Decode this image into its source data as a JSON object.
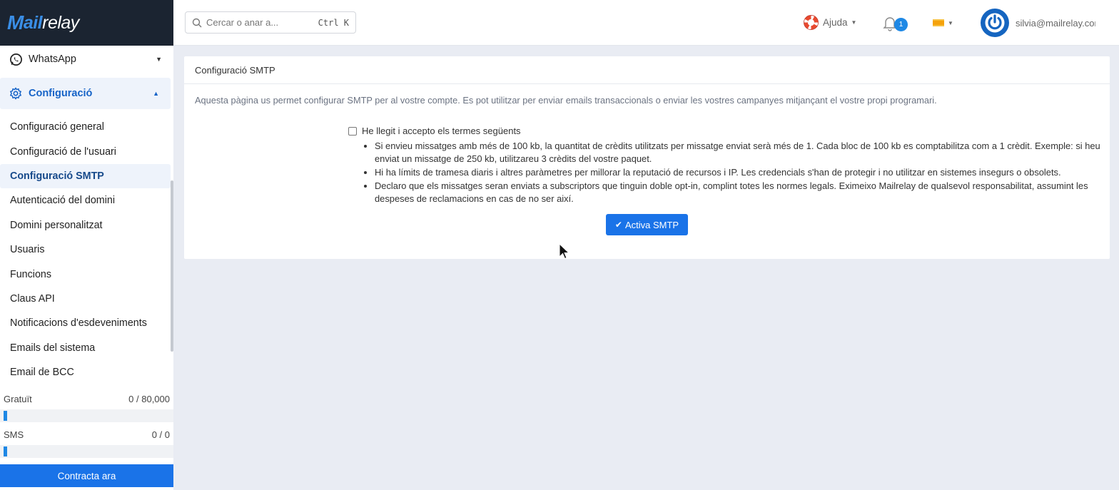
{
  "brand": {
    "logo_m": "M",
    "logo_ail": "ail",
    "logo_relay": "relay"
  },
  "sidebar": {
    "whatsapp_label": "WhatsApp",
    "config_label": "Configuració",
    "items": [
      {
        "label": "Configuració general"
      },
      {
        "label": "Configuració de l'usuari"
      },
      {
        "label": "Configuració SMTP"
      },
      {
        "label": "Autenticació del domini"
      },
      {
        "label": "Domini personalitzat"
      },
      {
        "label": "Usuaris"
      },
      {
        "label": "Funcions"
      },
      {
        "label": "Claus API"
      },
      {
        "label": "Notificacions d'esdeveniments"
      },
      {
        "label": "Emails del sistema"
      },
      {
        "label": "Email de BCC"
      }
    ],
    "active_index": 2
  },
  "quotas": [
    {
      "label": "Gratuït",
      "value": "0 / 80,000"
    },
    {
      "label": "SMS",
      "value": "0 / 0"
    }
  ],
  "contract_button": "Contracta ara",
  "header": {
    "search_placeholder": "Cercar o anar a...",
    "search_shortcut": "Ctrl K",
    "help_label": "Ajuda",
    "notification_count": "1",
    "user_email": "silvia@mailrelay.com"
  },
  "card": {
    "title": "Configuració SMTP",
    "description": "Aquesta pàgina us permet configurar SMTP per al vostre compte. Es pot utilitzar per enviar emails transaccionals o enviar les vostres campanyes mitjançant el vostre propi programari.",
    "terms_label": "He llegit i accepto els termes següents",
    "terms_checked": false,
    "terms": [
      "Si envieu missatges amb més de 100 kb, la quantitat de crèdits utilitzats per missatge enviat serà més de 1. Cada bloc de 100 kb es comptabilitza com a 1 crèdit. Exemple: si heu enviat un missatge de 250 kb, utilitzareu 3 crèdits del vostre paquet.",
      "Hi ha límits de tramesa diaris i altres paràmetres per millorar la reputació de recursos i IP. Les credencials s'han de protegir i no utilitzar en sistemes insegurs o obsolets.",
      "Declaro que els missatges seran enviats a subscriptors que tinguin doble opt-in, complint totes les normes legals. Eximeixo Mailrelay de qualsevol responsabilitat, assumint les despeses de reclamacions en cas de no ser així."
    ],
    "activate_label": "Activa SMTP"
  },
  "colors": {
    "primary": "#1a73e8",
    "sidebar_dark": "#1b2431",
    "active_bg": "#eef3fb"
  }
}
